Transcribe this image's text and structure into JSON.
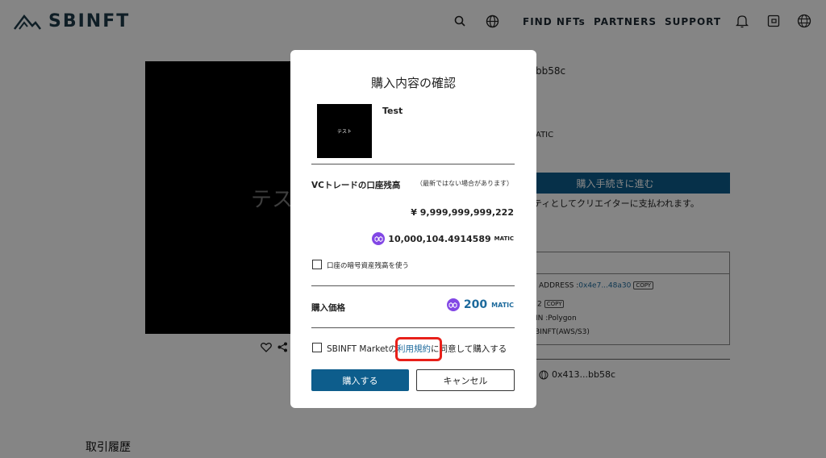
{
  "header": {
    "logo_text": "SBINFT",
    "nav": {
      "find_nfts": "FIND NFTs",
      "partners": "PARTNERS",
      "support": "SUPPORT"
    },
    "icons": [
      "search-icon",
      "globe-icon",
      "bell-icon",
      "wallet-icon",
      "language-icon"
    ]
  },
  "background_page": {
    "image_text": "テスト",
    "owner_suffix": "bb58c",
    "price_unit_partial": "ATIC",
    "proceed_button": "購入手続きに進む",
    "royalty_note": "リティとしてクリエイターに支払われます。",
    "contract_address_label": "ADDRESS :",
    "contract_address_value": "0x4e7...48a30",
    "copy_badge": "COPY",
    "token_id_partial": "2",
    "chain_partial": "IN :Polygon",
    "storage_partial": "BINFT(AWS/S3)",
    "creator_address": "0x413...bb58c",
    "history_heading": "取引履歴"
  },
  "modal": {
    "title": "購入内容の確認",
    "thumbnail_text": "テスト",
    "item_name": "Test",
    "balance_label": "VCトレードの口座残高",
    "balance_note": "（最新ではない場合があります）",
    "balance_jpy": "¥ 9,999,999,999,222",
    "balance_matic": "10,000,104.4914589",
    "matic_unit": "MATIC",
    "use_crypto_label": "口座の暗号資産残高を使う",
    "price_label": "購入価格",
    "price_value": "200",
    "price_unit": "MATIC",
    "terms_prefix": "SBINFT Marketの",
    "terms_link": "利用規約",
    "terms_suffix": "に同意して購入する",
    "buy_button": "購入する",
    "cancel_button": "キャンセル"
  },
  "colors": {
    "accent": "#0d5d8c",
    "link": "#1d6a9c",
    "matic": "#8247e5",
    "highlight": "#e8201a"
  }
}
